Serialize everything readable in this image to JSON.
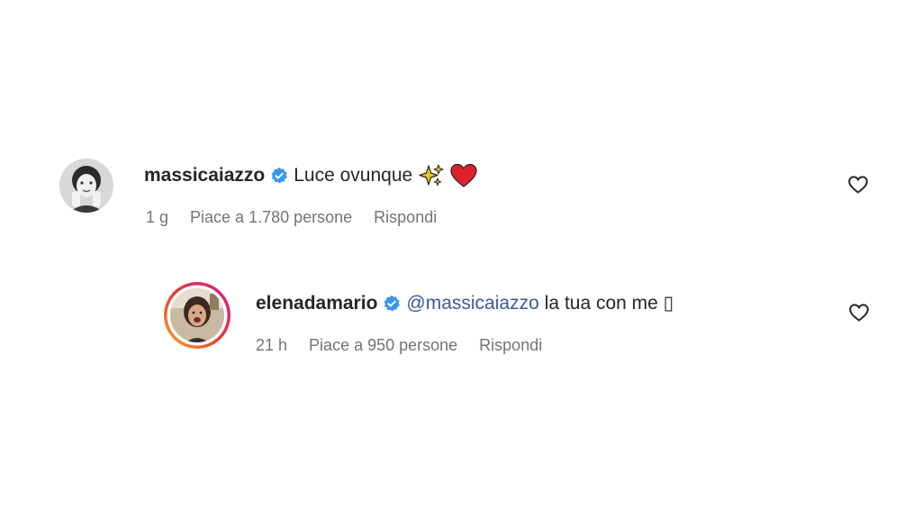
{
  "comments": [
    {
      "username": "massicaiazzo",
      "text": "Luce ovunque",
      "emojis": [
        "sparkles-icon",
        "red-heart-icon"
      ],
      "time": "1 g",
      "likes": "Piace a 1.780 persone",
      "reply_label": "Rispondi"
    },
    {
      "username": "elenadamario",
      "mention": "@massicaiazzo",
      "text": "la tua con me ▯",
      "time": "21 h",
      "likes": "Piace a 950 persone",
      "reply_label": "Rispondi"
    }
  ],
  "colors": {
    "verified": "#3897f0",
    "mention": "#3a5a9a",
    "meta": "#737373",
    "story_ring_start": "#f9a825",
    "story_ring_end": "#d81b92",
    "heart_emoji": "#e0202e"
  }
}
